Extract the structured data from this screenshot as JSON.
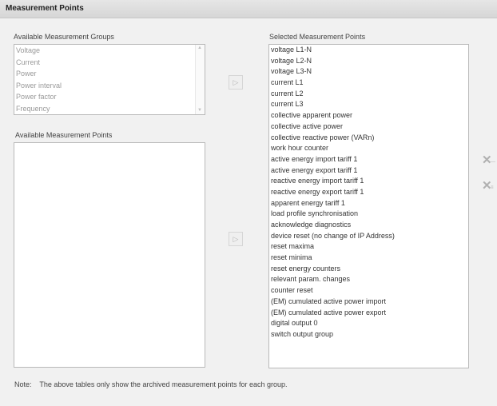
{
  "panel": {
    "title": "Measurement Points"
  },
  "groups": {
    "label": "Available Measurement Groups",
    "items": [
      "Voltage",
      "Current",
      "Power",
      "Power interval",
      "Power factor",
      "Frequency"
    ]
  },
  "points": {
    "label": "Available Measurement Points"
  },
  "selected": {
    "label": "Selected Measurement Points",
    "items": [
      "voltage L1-N",
      "voltage L2-N",
      "voltage L3-N",
      "current L1",
      "current L2",
      "current L3",
      "collective apparent power",
      "collective active power",
      "collective reactive power (VARn)",
      "work hour counter",
      "active energy import tariff 1",
      "active energy export tariff 1",
      "reactive energy import tariff 1",
      "reactive energy export tariff 1",
      "apparent energy tariff 1",
      "load profile synchronisation",
      "acknowledge diagnostics",
      "device reset (no change of IP Address)",
      "reset maxima",
      "reset minima",
      "reset energy counters",
      "relevant param. changes",
      "counter reset",
      "(EM) cumulated active power import",
      "(EM) cumulated active power export",
      "digital output 0",
      "switch output group"
    ]
  },
  "buttons": {
    "add_group_glyph": "▷",
    "add_point_glyph": "▷",
    "remove_one_glyph": "✕",
    "remove_all_glyph": "✕"
  },
  "footer": {
    "note_label": "Note:",
    "note_text": "The above tables only show the archived measurement points for each group."
  },
  "icons": [
    "arrow-right-icon",
    "remove-icon",
    "remove-all-icon",
    "scroll-up-icon",
    "scroll-down-icon"
  ]
}
